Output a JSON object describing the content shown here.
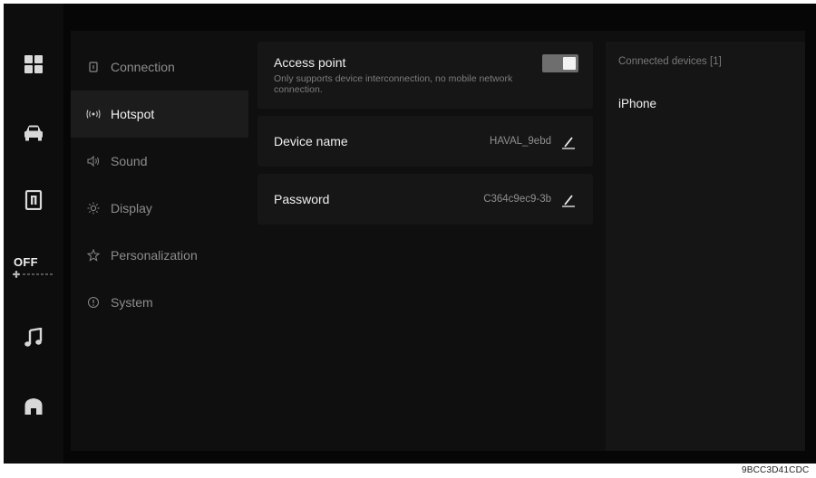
{
  "rail": {
    "items": [
      {
        "icon": "apps-grid-icon"
      },
      {
        "icon": "car-icon"
      },
      {
        "icon": "manual-icon"
      },
      {
        "icon": "music-icon"
      },
      {
        "icon": "home-icon"
      }
    ],
    "climate": {
      "label": "OFF",
      "icon": "fan-icon"
    }
  },
  "menu": {
    "active": "Hotspot",
    "items": [
      {
        "label": "Connection",
        "icon": "connection-icon"
      },
      {
        "label": "Hotspot",
        "icon": "hotspot-icon"
      },
      {
        "label": "Sound",
        "icon": "sound-icon"
      },
      {
        "label": "Display",
        "icon": "display-icon"
      },
      {
        "label": "Personalization",
        "icon": "personalization-icon"
      },
      {
        "label": "System",
        "icon": "system-icon"
      }
    ]
  },
  "hotspot": {
    "access_point": {
      "title": "Access point",
      "description": "Only supports device interconnection, no mobile network connection.",
      "enabled": true
    },
    "device_name": {
      "label": "Device name",
      "value": "HAVAL_9ebd"
    },
    "password": {
      "label": "Password",
      "value": "C364c9ec9-3b"
    }
  },
  "devices": {
    "header": "Connected devices [1]",
    "list": [
      "iPhone"
    ]
  },
  "watermark": "9BCC3D41CDC",
  "colors": {
    "background": "#060606",
    "panel": "#0f0f0f",
    "card": "#161616",
    "active": "#1c1c1c",
    "toggle": "#6e6e6e"
  }
}
